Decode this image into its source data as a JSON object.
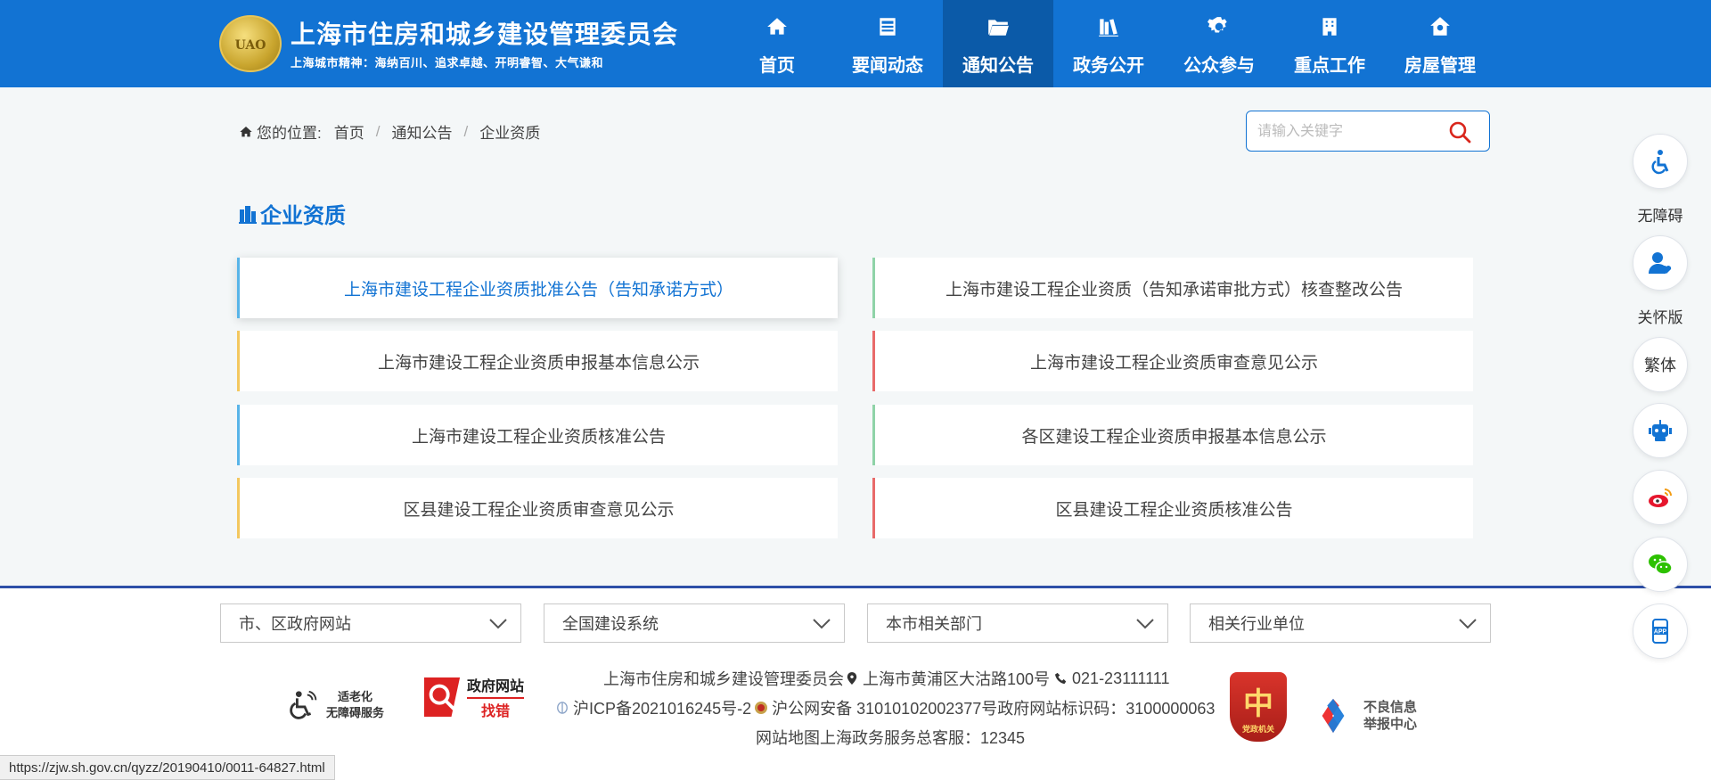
{
  "header": {
    "title": "上海市住房和城乡建设管理委员会",
    "slogan": "上海城市精神：海纳百川、追求卓越、开明睿智、大气谦和",
    "emblem_text": "UAO",
    "brand_color": "#1273d3",
    "nav": [
      {
        "label": "首页",
        "icon": "home-icon"
      },
      {
        "label": "要闻动态",
        "icon": "news-icon"
      },
      {
        "label": "通知公告",
        "icon": "folder-icon",
        "active": true
      },
      {
        "label": "政务公开",
        "icon": "books-icon"
      },
      {
        "label": "公众参与",
        "icon": "gear-icon"
      },
      {
        "label": "重点工作",
        "icon": "building-icon"
      },
      {
        "label": "房屋管理",
        "icon": "house-gear-icon"
      }
    ]
  },
  "breadcrumb": {
    "prefix": "您的位置:",
    "items": [
      "首页",
      "通知公告",
      "企业资质"
    ]
  },
  "search": {
    "placeholder": "请输入关键字",
    "value": ""
  },
  "section": {
    "title": "企业资质"
  },
  "cards": [
    {
      "label": "上海市建设工程企业资质批准公告（告知承诺方式）",
      "bar_color": "#58b4e8",
      "highlight": true
    },
    {
      "label": "上海市建设工程企业资质（告知承诺审批方式）核查整改公告",
      "bar_color": "#8fd3a8"
    },
    {
      "label": "上海市建设工程企业资质申报基本信息公示",
      "bar_color": "#f3c75f"
    },
    {
      "label": "上海市建设工程企业资质审查意见公示",
      "bar_color": "#e86a6a"
    },
    {
      "label": "上海市建设工程企业资质核准公告",
      "bar_color": "#58b4e8"
    },
    {
      "label": "各区建设工程企业资质申报基本信息公示",
      "bar_color": "#8fd3a8"
    },
    {
      "label": "区县建设工程企业资质审查意见公示",
      "bar_color": "#f3c75f"
    },
    {
      "label": "区县建设工程企业资质核准公告",
      "bar_color": "#e86a6a"
    }
  ],
  "footer": {
    "dropdowns": [
      "市、区政府网站",
      "全国建设系统",
      "本市相关部门",
      "相关行业单位"
    ],
    "org_name": "上海市住房和城乡建设管理委员会",
    "address": "上海市黄浦区大沽路100号",
    "phone": "021-23111111",
    "icp": "沪ICP备2021016245号-2",
    "police_record": "沪公网安备 31010102002377号",
    "site_id": "政府网站标识码：3100000063",
    "sitemap": "网站地图",
    "hotline": "上海政务服务总客服：12345",
    "badge_accessible": [
      "适老化",
      "无障碍服务"
    ],
    "badge_gov_top": "政府网站",
    "badge_gov_bottom": "找错",
    "badge_party_big": "中",
    "badge_party_small": "党政机关",
    "badge_report": [
      "不良信息",
      "举报中心"
    ]
  },
  "side_tools": [
    {
      "icon": "accessibility-icon",
      "label": "无障碍"
    },
    {
      "icon": "care-user-icon",
      "label": "关怀版"
    },
    {
      "text": "繁体"
    },
    {
      "icon": "robot-icon"
    },
    {
      "icon": "weibo-icon"
    },
    {
      "icon": "wechat-icon"
    },
    {
      "icon": "app-icon",
      "text": "APP"
    }
  ],
  "status_url": "https://zjw.sh.gov.cn/qyzz/20190410/0011-64827.html"
}
